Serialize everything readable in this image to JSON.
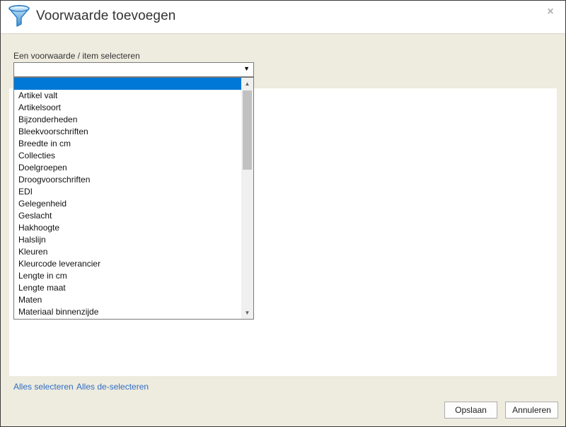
{
  "dialog": {
    "title": "Voorwaarde toevoegen",
    "icon": "filter-funnel-icon",
    "close_glyph": "×"
  },
  "condition": {
    "label": "Een voorwaarde / item selecteren",
    "selected_value": "",
    "arrow_glyph": "▼"
  },
  "dropdown": {
    "selected_index": 0,
    "items": [
      "",
      "Artikel valt",
      "Artikelsoort",
      "Bijzonderheden",
      "Bleekvoorschriften",
      "Breedte in cm",
      "Collecties",
      "Doelgroepen",
      "Droogvoorschriften",
      "EDI",
      "Gelegenheid",
      "Geslacht",
      "Hakhoogte",
      "Halslijn",
      "Kleuren",
      "Kleurcode leverancier",
      "Lengte in cm",
      "Lengte maat",
      "Maten",
      "Materiaal binnenzijde"
    ]
  },
  "links": {
    "select_all": "Alles selecteren",
    "deselect_all": "Alles de-selecteren"
  },
  "buttons": {
    "save": "Opslaan",
    "cancel": "Annuleren"
  },
  "colors": {
    "selection": "#0078d7",
    "link": "#2f6ec4",
    "dialog_bg": "#eeebdf",
    "icon_blue": "#3a8fd6"
  }
}
